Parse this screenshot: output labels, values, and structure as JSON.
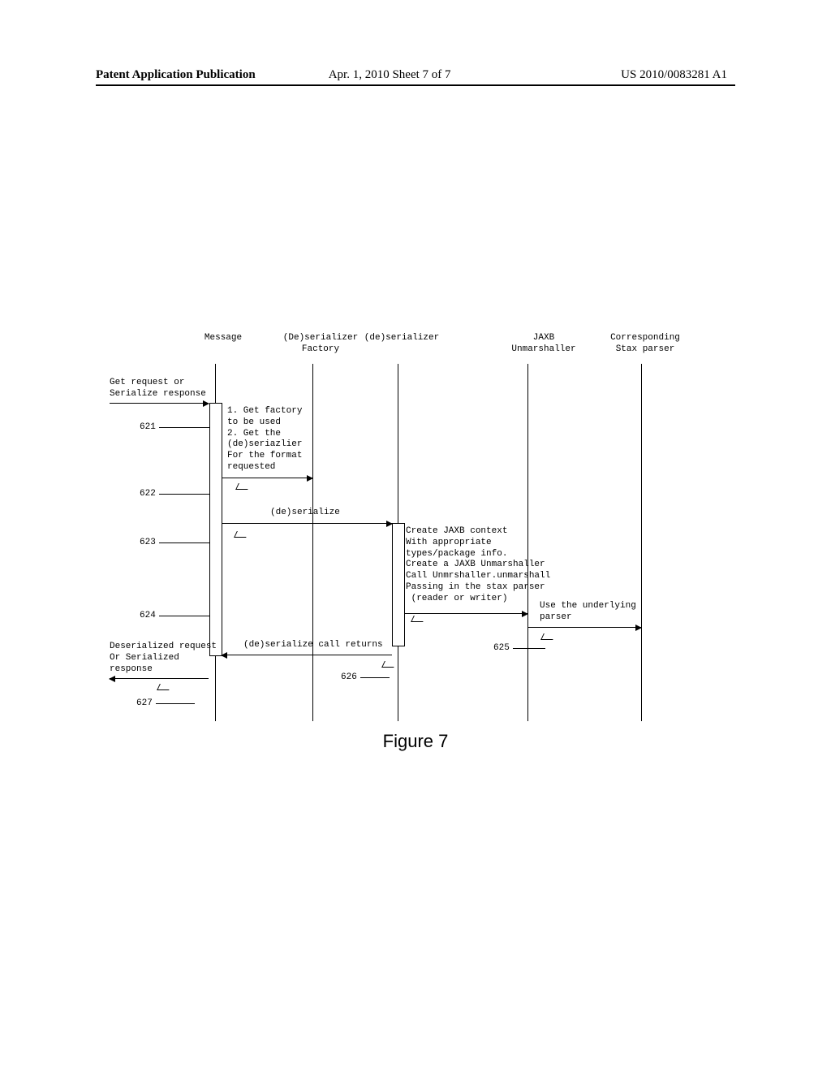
{
  "header": {
    "left": "Patent Application Publication",
    "center": "Apr. 1, 2010  Sheet 7 of 7",
    "right": "US 2010/0083281 A1"
  },
  "figure_caption": "Figure 7",
  "lifelines": {
    "l1": "Message",
    "l2": "(De)serializer\nFactory",
    "l3": "(de)serializer",
    "l4": "JAXB\nUnmarshaller",
    "l5": "Corresponding\nStax parser"
  },
  "texts": {
    "entry": "Get request or\nSerialize response",
    "step1": "1. Get factory\nto be used\n2. Get the\n(de)seriazlier\nFor the format\nrequested",
    "deserialize": "(de)serialize",
    "jaxb": "Create JAXB context\nWith appropriate\ntypes/package info.\nCreate a JAXB Unmarshaller\nCall Unmrshaller.unmarshall\nPassing in the stax parser\n (reader or writer)",
    "useparser": "Use the underlying\nparser",
    "callreturns": "(de)serialize call returns",
    "exit": "Deserialized request\nOr Serialized\nresponse"
  },
  "refs": {
    "r621": "621",
    "r622": "622",
    "r623": "623",
    "r624": "624",
    "r625": "625",
    "r626": "626",
    "r627": "627"
  }
}
